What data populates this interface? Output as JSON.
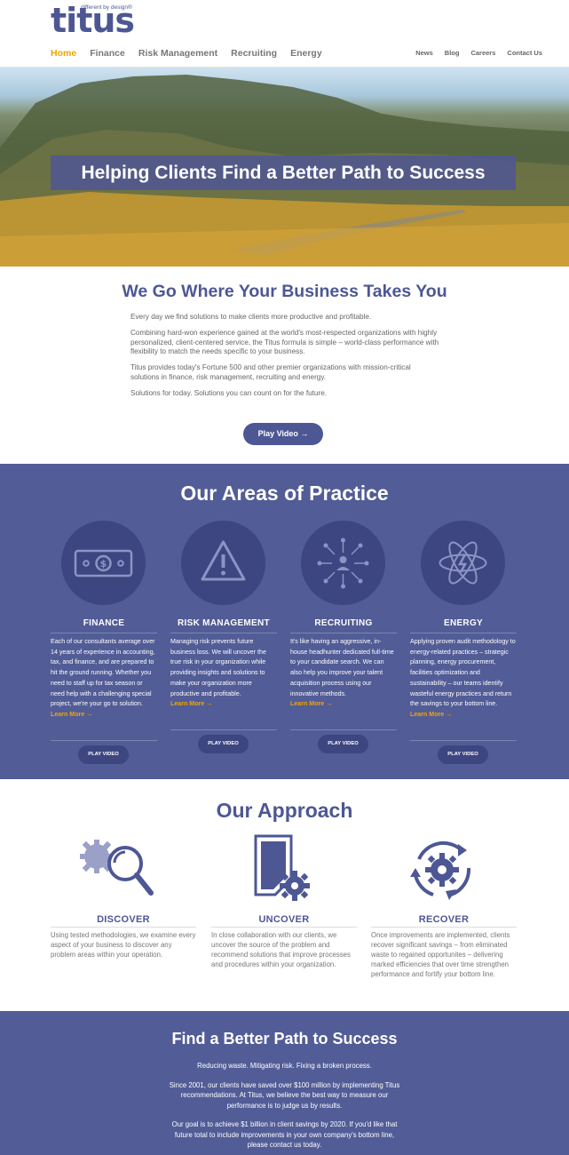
{
  "brand": {
    "name": "titus",
    "tagline": "different by design®"
  },
  "nav": {
    "main": [
      "Home",
      "Finance",
      "Risk Management",
      "Recruiting",
      "Energy"
    ],
    "utility": [
      "News",
      "Blog",
      "Careers",
      "Contact Us"
    ]
  },
  "hero": {
    "title": "Helping Clients Find a Better Path to Success"
  },
  "intro": {
    "heading": "We Go Where Your Business Takes You",
    "paragraphs": [
      "Every day we find solutions to make clients more productive and profitable.",
      "Combining hard-won experience gained at the world's most-respected organizations with highly personalized, client-centered service, the Titus formula is simple – world-class performance with flexibility to match the needs specific to your business.",
      "Titus provides today's Fortune 500 and other premier organizations with mission-critical solutions in finance, risk management, recruiting and energy.",
      "Solutions for today. Solutions you can count on for the future."
    ],
    "button": "Play Video →"
  },
  "practice": {
    "heading": "Our Areas of Practice",
    "areas": [
      {
        "icon": "money-icon",
        "title": "FINANCE",
        "text": "Each of our consultants average over 14 years of experience in accounting, tax, and finance, and are prepared to hit the ground running. Whether you need to staff up for tax season or need help with a challenging special project, we're your go to solution.",
        "link": "Learn More →",
        "button": "PLAY VIDEO"
      },
      {
        "icon": "warning-icon",
        "title": "RISK MANAGEMENT",
        "text": "Managing risk prevents future business loss. We will uncover the true risk in your organization while providing insights and solutions to make your organization more productive and profitable.",
        "link": "Learn More →",
        "button": "PLAY VIDEO"
      },
      {
        "icon": "network-icon",
        "title": "RECRUITING",
        "text": "It's like having an aggressive, in-house headhunter dedicated full-time to your candidate search. We can also help you improve your talent acquisition process using our innovative methods.",
        "link": "Learn More →",
        "button": "PLAY VIDEO"
      },
      {
        "icon": "atom-icon",
        "title": "ENERGY",
        "text": "Applying proven audit methodology to energy-related practices – strategic planning, energy procurement, facilities optimization and sustainability – our teams identify wasteful energy practices and return the savings to your bottom line.",
        "link": "Learn More →",
        "button": "PLAY VIDEO"
      }
    ]
  },
  "approach": {
    "heading": "Our Approach",
    "steps": [
      {
        "icon": "magnifier-gear-icon",
        "title": "DISCOVER",
        "text": "Using tested methodologies, we examine every aspect of your business to discover any problem areas within your operation."
      },
      {
        "icon": "document-gear-icon",
        "title": "UNCOVER",
        "text": "In close collaboration with our clients, we uncover the source of the problem and recommend solutions that improve processes and procedures within your organization."
      },
      {
        "icon": "cycle-gear-icon",
        "title": "RECOVER",
        "text": "Once improvements are implemented, clients recover significant savings – from eliminated waste to regained opportunites – delivering marked efficiencies that over time strengthen performance and fortify your bottom line."
      }
    ]
  },
  "better": {
    "heading": "Find a Better Path to Success",
    "paragraphs": [
      "Reducing waste. Mitigating risk. Fixing a broken process.",
      "Since 2001, our clients have saved over $100 million by implementing Titus recommendations. At Titus, we believe the best way to measure our performance is to judge us by results.",
      "Our goal is to achieve $1 billion in client savings by 2020. If you'd like that future total to include improvements in your own company's bottom line, please contact us today."
    ]
  },
  "colors": {
    "primary": "#525c96",
    "accent": "#f0a500",
    "dark_circle": "#3d4680"
  }
}
